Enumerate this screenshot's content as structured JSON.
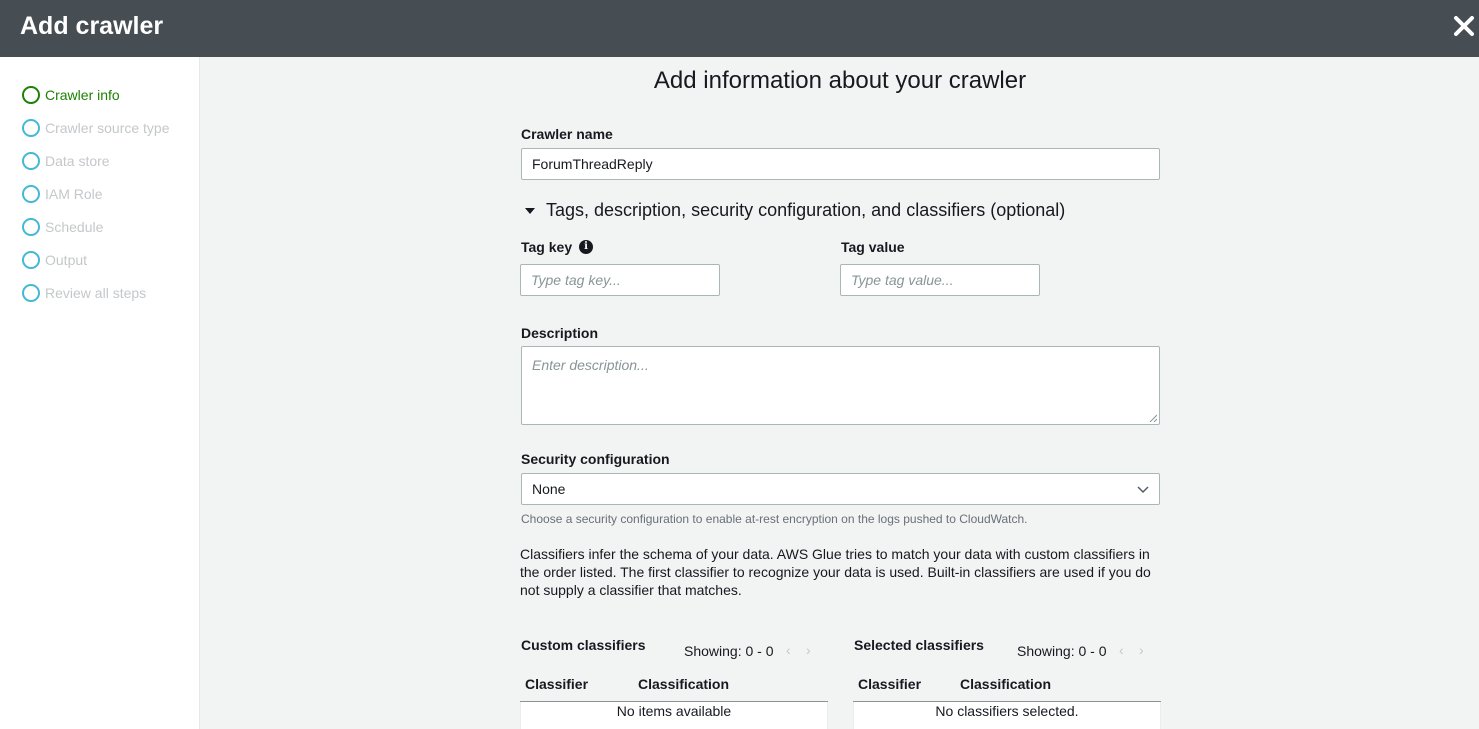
{
  "header": {
    "title": "Add crawler"
  },
  "steps": [
    {
      "label": "Crawler info",
      "active": true
    },
    {
      "label": "Crawler source type",
      "active": false
    },
    {
      "label": "Data store",
      "active": false
    },
    {
      "label": "IAM Role",
      "active": false
    },
    {
      "label": "Schedule",
      "active": false
    },
    {
      "label": "Output",
      "active": false
    },
    {
      "label": "Review all steps",
      "active": false
    }
  ],
  "main": {
    "heading": "Add information about your crawler",
    "crawler_name": {
      "label": "Crawler name",
      "value": "ForumThreadReply"
    },
    "expander": "Tags, description, security configuration, and classifiers (optional)",
    "tag_key": {
      "label": "Tag key",
      "placeholder": "Type tag key..."
    },
    "tag_value": {
      "label": "Tag value",
      "placeholder": "Type tag value..."
    },
    "description": {
      "label": "Description",
      "placeholder": "Enter description..."
    },
    "security": {
      "label": "Security configuration",
      "value": "None",
      "hint": "Choose a security configuration to enable at-rest encryption on the logs pushed to CloudWatch."
    },
    "classifiers_paragraph": "Classifiers infer the schema of your data. AWS Glue tries to match your data with custom classifiers in the order listed. The first classifier to recognize your data is used. Built-in classifiers are used if you do not supply a classifier that matches.",
    "custom_table": {
      "title": "Custom classifiers",
      "showing": "Showing: 0 - 0",
      "columns": [
        "Classifier",
        "Classification"
      ],
      "empty": "No items available"
    },
    "selected_table": {
      "title": "Selected classifiers",
      "showing": "Showing: 0 - 0",
      "columns": [
        "Classifier",
        "Classification"
      ],
      "empty": "No classifiers selected."
    }
  },
  "icons": {
    "close": "close-icon",
    "info": "info-icon",
    "select_arrow": "chevron-down-icon",
    "pager_prev": "chevron-left-icon",
    "pager_next": "chevron-right-icon"
  },
  "colors": {
    "header_bg": "#464e53",
    "active_step": "#1d8102",
    "step_circle": "#44b9d6",
    "inactive_step_text": "#c4c8ca"
  }
}
